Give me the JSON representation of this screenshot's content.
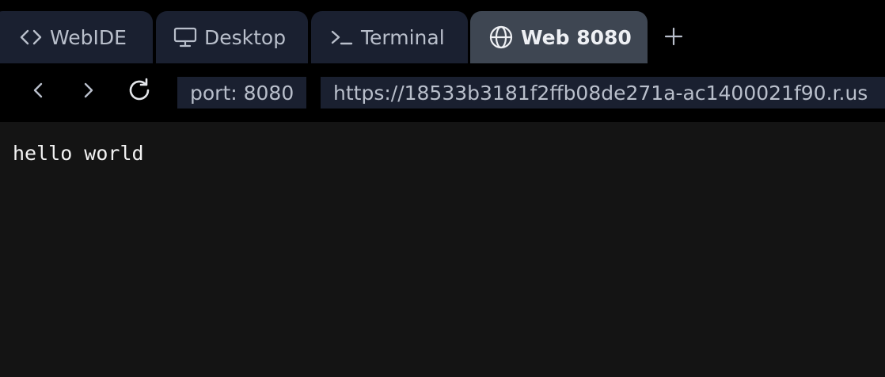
{
  "tabs": [
    {
      "label": "WebIDE",
      "icon": "code-icon",
      "active": false
    },
    {
      "label": "Desktop",
      "icon": "monitor-icon",
      "active": false
    },
    {
      "label": "Terminal",
      "icon": "terminal-icon",
      "active": false
    },
    {
      "label": "Web 8080",
      "icon": "globe-icon",
      "active": true
    }
  ],
  "new_tab_icon": "plus-icon",
  "navigation": {
    "back_icon": "chevron-left-icon",
    "forward_icon": "chevron-right-icon",
    "reload_icon": "reload-icon",
    "port_label": "port: 8080",
    "url": "https://18533b3181f2ffb08de271a-ac1400021f90.r.us"
  },
  "page": {
    "text": "hello world"
  },
  "colors": {
    "tab_bg": "#1a2030",
    "tab_active_bg": "#3e4652",
    "chrome_bg": "#000000",
    "content_bg": "#141414",
    "text": "#b9bfcb"
  }
}
